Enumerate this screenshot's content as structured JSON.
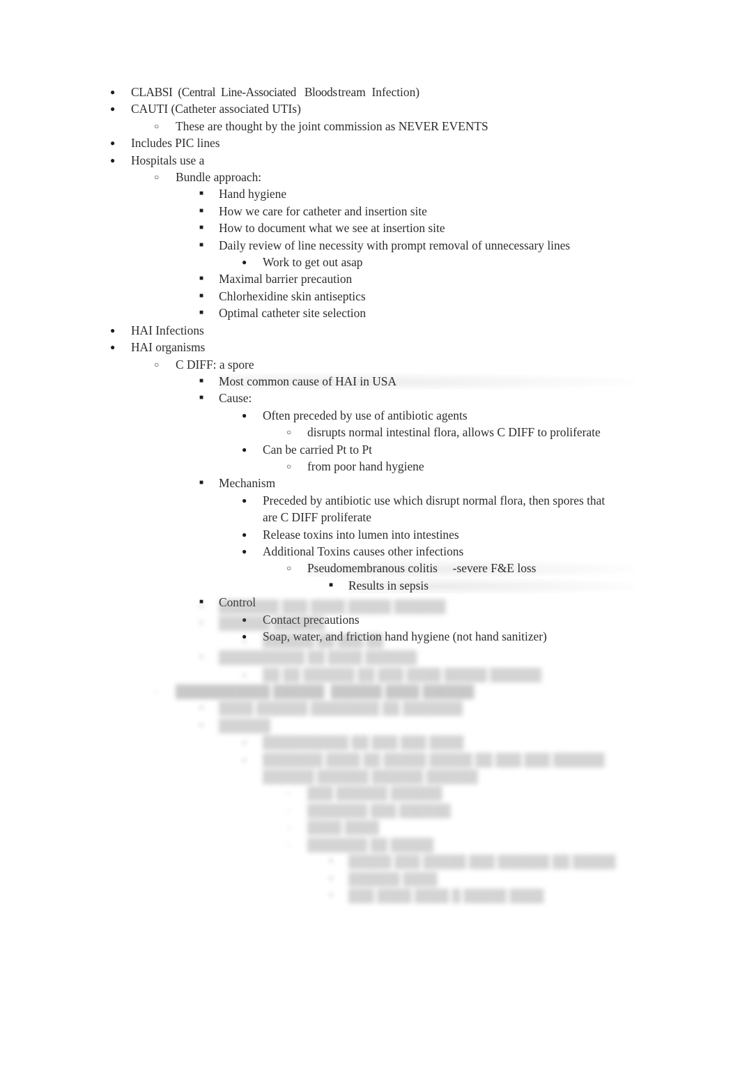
{
  "document": {
    "title": "Nursing Notes — HAI / CLABSI / C DIFF",
    "page_background": "#ffffff",
    "text_color": "#2d2d2d",
    "bullet_glyphs": {
      "level1": "●",
      "level2": "○",
      "level3": "■",
      "level4": "●",
      "level5": "○",
      "level6": "■"
    }
  },
  "outline": [
    {
      "level": 1,
      "text_pre": "CLABSI  (Central  Line-Associated   Blood",
      "text_kern": "s",
      "text_post": "tream  Infection)"
    },
    {
      "level": 1,
      "text": "CAUTI (Catheter associated UTIs)"
    },
    {
      "level": 2,
      "text": "These are thought by the joint commission as NEVER EVENTS"
    },
    {
      "level": 1,
      "text": "Includes PIC lines"
    },
    {
      "level": 1,
      "text": "Hospitals use a"
    },
    {
      "level": 2,
      "text": "Bundle approach:"
    },
    {
      "level": 3,
      "text": "Hand hygiene"
    },
    {
      "level": 3,
      "text": "How we care for catheter and insertion site"
    },
    {
      "level": 3,
      "text": "How to document what we see at insertion site"
    },
    {
      "level": 3,
      "text": "Daily review of line necessity with prompt removal of unnecessary lines"
    },
    {
      "level": 4,
      "text": "Work to get out asap"
    },
    {
      "level": 3,
      "text": "Maximal barrier precaution"
    },
    {
      "level": 3,
      "text": "Chlorhexidine skin antiseptics"
    },
    {
      "level": 3,
      "text": "Optimal catheter site selection"
    },
    {
      "level": 1,
      "text": "HAI Infections"
    },
    {
      "level": 1,
      "text": "HAI organisms"
    },
    {
      "level": 2,
      "text": "C DIFF: a spore"
    },
    {
      "level": 3,
      "text": "Most common cause of HAI in USA",
      "halo": true
    },
    {
      "level": 3,
      "text": "Cause:"
    },
    {
      "level": 4,
      "text": "Often preceded by use of antibiotic agents"
    },
    {
      "level": 5,
      "text": "disrupts normal intestinal flora, allows C DIFF to proliferate"
    },
    {
      "level": 4,
      "text": "Can be carried Pt to Pt"
    },
    {
      "level": 5,
      "text": "from poor hand hygiene"
    },
    {
      "level": 3,
      "text": "Mechanism"
    },
    {
      "level": 4,
      "text": "Preceded by antibiotic use which disrupt normal flora, then spores that are C DIFF proliferate"
    },
    {
      "level": 4,
      "text": "Release toxins into lumen into intestines"
    },
    {
      "level": 4,
      "text": "Additional Toxins causes other infections"
    },
    {
      "level": 5,
      "text": "Pseudomembranous colitis     -severe F&E loss",
      "halo": true
    },
    {
      "level": 6,
      "text": "Results in sepsis",
      "halo": true
    },
    {
      "level": 3,
      "text": "Control"
    },
    {
      "level": 4,
      "text": "Contact precautions"
    },
    {
      "level": 4,
      "text": "Soap, water, and friction hand hygiene (not hand sanitizer)"
    }
  ],
  "obscured_section": {
    "note": "Lower portion of the page is blurred and illegible in the screenshot.",
    "rows": [
      {
        "level": 3,
        "text": "███████ ███ ████ █████ ██████"
      },
      {
        "level": 3,
        "text": "██████ ██████"
      },
      {
        "level": 4,
        "text": "██████ ██ ███ ██"
      },
      {
        "level": 3,
        "text": "██████████ ██ ████ ██████"
      },
      {
        "level": 4,
        "text": "██ ██ ██████ ██ ███ ████ █████ ██████"
      },
      {
        "level": 2,
        "text": "███████████ ██████  ██████ ████ ██████",
        "bold": true
      },
      {
        "level": 3,
        "text": "████ ██████ ████████ ██ ███████"
      },
      {
        "level": 3,
        "text": "██████"
      },
      {
        "level": 4,
        "text": "██████████ ██ ███ ███ ████"
      },
      {
        "level": 4,
        "text": "███████ ████ ██ █████ █████ ██ ███ ███ ██████ ██████ ██████ ██████ ██████"
      },
      {
        "level": 5,
        "text": "███ ██████ ██████"
      },
      {
        "level": 5,
        "text": "███████ ███ ██████"
      },
      {
        "level": 5,
        "text": "████ ████"
      },
      {
        "level": 5,
        "text": "███████ ██ █████"
      },
      {
        "level": 6,
        "text": "█████ ███ █████ ███ ██████ ██ █████"
      },
      {
        "level": 6,
        "text": "██████ ████"
      },
      {
        "level": 6,
        "text": "███ ████ ████ █ █████ ████"
      }
    ]
  }
}
